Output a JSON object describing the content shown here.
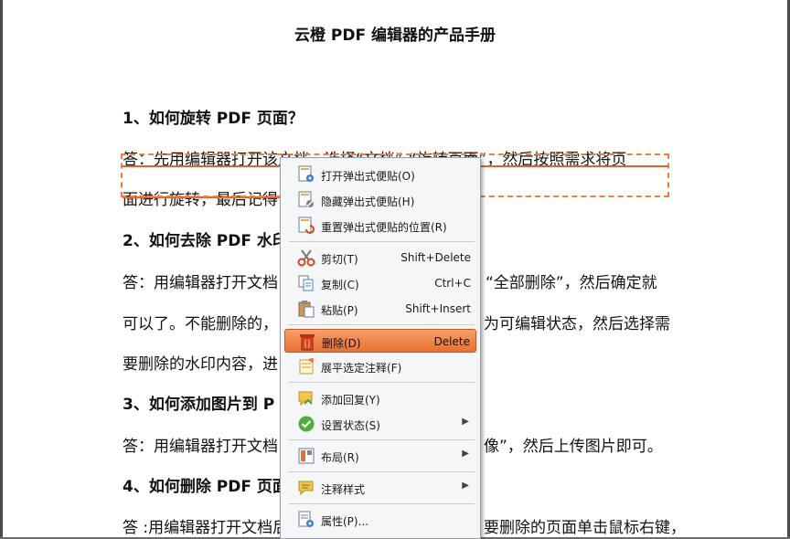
{
  "document": {
    "title": "云橙 PDF 编辑器的产品手册",
    "q1": {
      "heading": "1、如何旋转  PDF  页面？",
      "line1": "答：先用编辑器打开该文档，选择“文档”-“旋转页面”，然后按照需求将页",
      "line2": "面进行旋转，最后记得"
    },
    "q2": {
      "heading": "2、如何去除  PDF  水印",
      "line1a": "答：用编辑器打开文档",
      "line1b": "“全部删除”，然后确定就",
      "line2a": "可以了。不能删除的，",
      "line2b": "为可编辑状态，然后选择需",
      "line3": "要删除的水印内容，进"
    },
    "q3": {
      "heading": "3、如何添加图片到  P",
      "line1a": "答：用编辑器打开文档",
      "line1b": "像”，然后上传图片即可。"
    },
    "q4": {
      "heading": "4、如何删除  PDF  页面",
      "line1a": "答 :用编辑器打开文档后",
      "line1b": "要删除的页面单击鼠标右键，"
    }
  },
  "context_menu": {
    "items": [
      {
        "label": "打开弹出式便贴(O)",
        "shortcut": "",
        "icon": "note-open-icon"
      },
      {
        "label": "隐藏弹出式便贴(H)",
        "shortcut": "",
        "icon": "note-hide-icon"
      },
      {
        "label": "重置弹出式便贴的位置(R)",
        "shortcut": "",
        "icon": "note-reset-icon"
      },
      {
        "label": "剪切(T)",
        "shortcut": "Shift+Delete",
        "icon": "scissors-icon"
      },
      {
        "label": "复制(C)",
        "shortcut": "Ctrl+C",
        "icon": "copy-icon"
      },
      {
        "label": "粘贴(P)",
        "shortcut": "Shift+Insert",
        "icon": "paste-icon"
      },
      {
        "label": "删除(D)",
        "shortcut": "Delete",
        "icon": "trash-icon",
        "highlighted": true
      },
      {
        "label": "展平选定注释(F)",
        "shortcut": "",
        "icon": "flatten-icon"
      },
      {
        "label": "添加回复(Y)",
        "shortcut": "",
        "icon": "reply-icon"
      },
      {
        "label": "设置状态(S)",
        "shortcut": "",
        "icon": "check-circle-icon",
        "submenu": true
      },
      {
        "label": "布局(R)",
        "shortcut": "",
        "icon": "layout-icon",
        "submenu": true
      },
      {
        "label": "注释样式",
        "shortcut": "",
        "icon": "comment-style-icon",
        "submenu": true
      },
      {
        "label": "属性(P)...",
        "shortcut": "",
        "icon": "properties-icon"
      }
    ],
    "submenu_arrow": "▶"
  },
  "colors": {
    "accent": "#e8702e",
    "annotation": "#f07f3c"
  }
}
